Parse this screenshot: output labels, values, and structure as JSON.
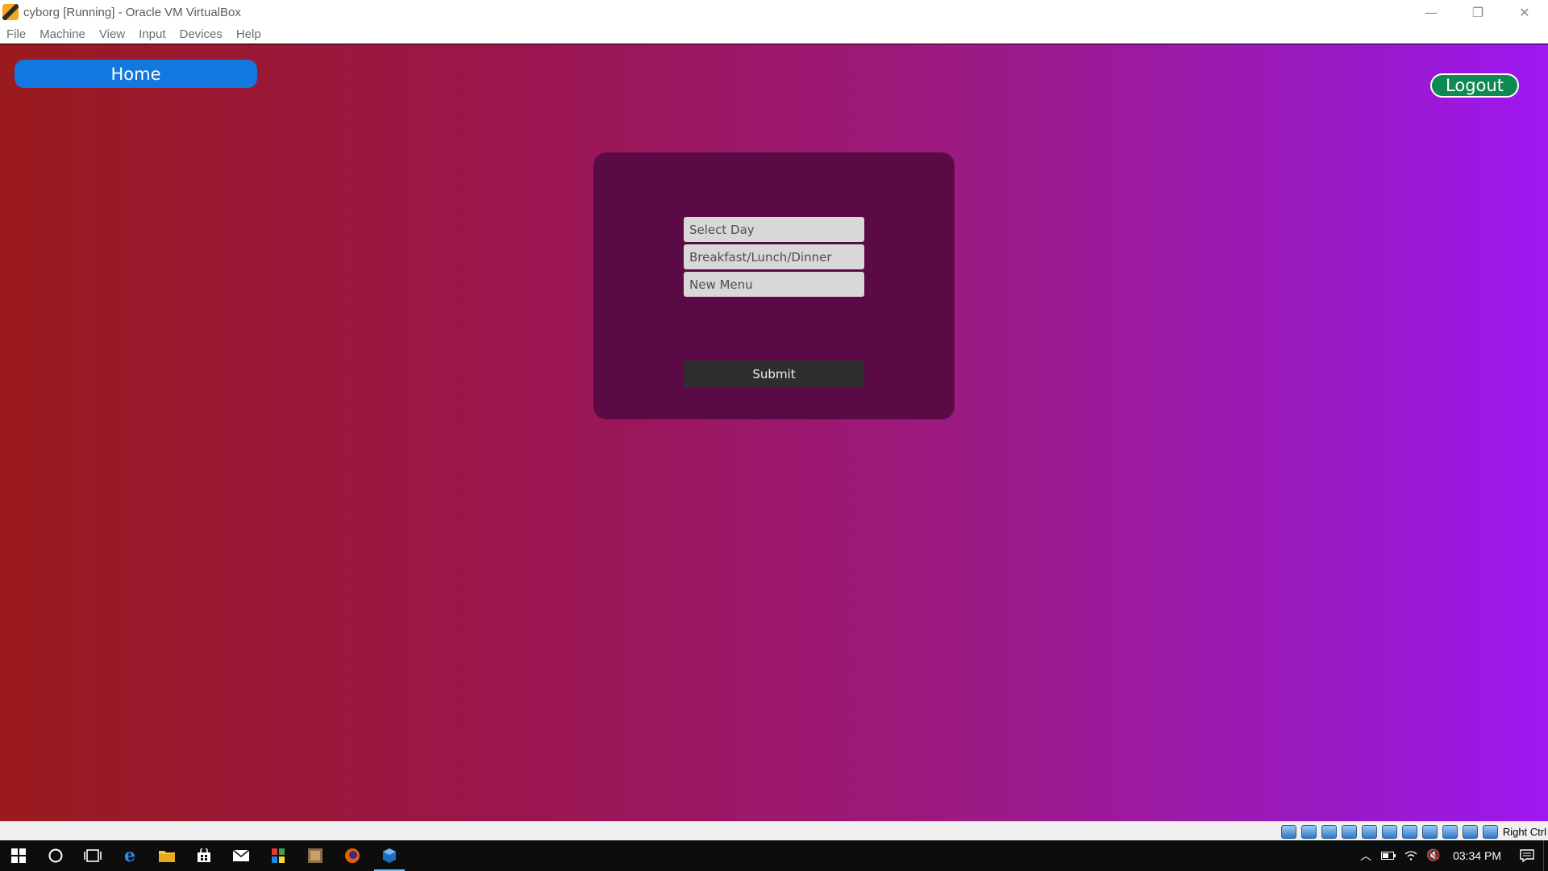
{
  "window": {
    "title": "cyborg [Running] - Oracle VM VirtualBox",
    "controls": {
      "minimize": "—",
      "restore": "❐",
      "close": "✕"
    }
  },
  "menu": {
    "items": [
      {
        "label": "File"
      },
      {
        "label": "Machine"
      },
      {
        "label": "View"
      },
      {
        "label": "Input"
      },
      {
        "label": "Devices"
      },
      {
        "label": "Help"
      }
    ]
  },
  "app": {
    "home_label": "Home",
    "logout_label": "Logout",
    "form": {
      "day_placeholder": "Select Day",
      "meal_placeholder": "Breakfast/Lunch/Dinner",
      "menu_placeholder": "New Menu",
      "submit_label": "Submit"
    },
    "colors": {
      "home_button": "#1278e0",
      "logout_button": "#0c8a52",
      "card": "#5a0b45",
      "submit_button": "#2e2e2e"
    }
  },
  "vbox_status": {
    "host_key": "Right Ctrl",
    "icons": [
      "hard-disk-icon",
      "optical-drive-icon",
      "audio-icon",
      "network-icon",
      "usb-icon",
      "shared-folders-icon",
      "display-icon",
      "video-capture-icon",
      "cpu-icon",
      "mouse-integration-icon",
      "keyboard-icon"
    ]
  },
  "taskbar": {
    "apps": [
      "windows-start-icon",
      "cortana-search-icon",
      "task-view-icon",
      "edge-icon",
      "file-explorer-icon",
      "store-icon",
      "mail-icon",
      "tiles-app-icon",
      "terminal-app-icon",
      "firefox-icon",
      "virtualbox-icon"
    ],
    "clock": "03:34 PM"
  }
}
